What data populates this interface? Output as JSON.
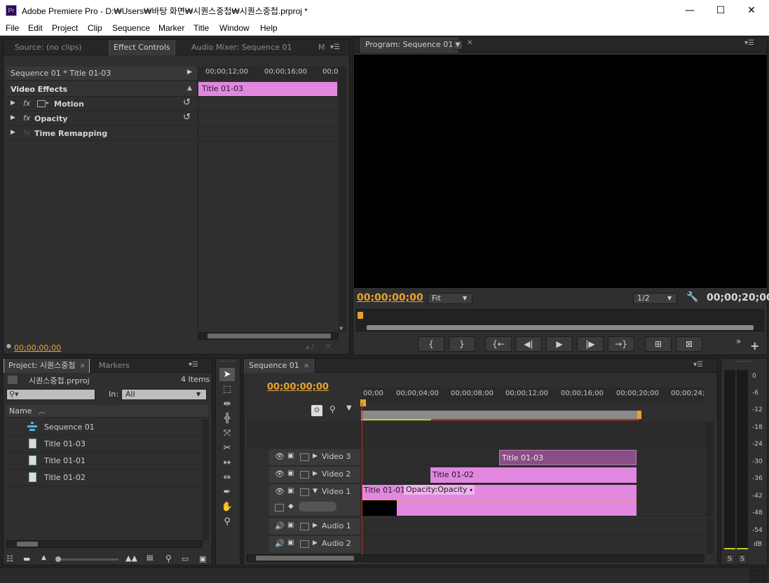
{
  "app": {
    "logo": "Pr",
    "window_title": "Adobe Premiere Pro - D:₩Users₩바탕 화면₩시퀀스중첩₩시퀀스중첩.prproj *",
    "minimize": "—",
    "maximize": "☐",
    "close": "✕"
  },
  "menu": [
    "File",
    "Edit",
    "Project",
    "Clip",
    "Sequence",
    "Marker",
    "Title",
    "Window",
    "Help"
  ],
  "source_panel": {
    "tabs": [
      "Source: (no clips)",
      "Effect Controls",
      "Audio Mixer: Sequence 01",
      "M"
    ],
    "effect_header": "Sequence 01 * Title 01-03",
    "ruler": [
      "00;00;12;00",
      "00;00;16;00",
      "00;0"
    ],
    "clip_label": "Title 01-03",
    "section": "Video Effects",
    "effects": [
      "Motion",
      "Opacity",
      "Time Remapping"
    ],
    "timecode": "00;00;00;00"
  },
  "program_panel": {
    "tab": "Program: Sequence 01",
    "current_time": "00;00;00;00",
    "fit": "Fit",
    "resolution": "1/2",
    "duration": "00;00;20;00",
    "controls": [
      "{",
      "}",
      "{←",
      "◀|",
      "▶",
      "|▶",
      "→}",
      "⊞",
      "⊠"
    ]
  },
  "project_panel": {
    "tabs": [
      "Project: 시퀀스중첩",
      "Markers"
    ],
    "project_name": "시퀀스중첩.prproj",
    "item_count": "4 Items",
    "search_placeholder": "",
    "in_label": "In:",
    "in_value": "All",
    "name_header": "Name",
    "items": [
      "Sequence 01",
      "Title 01-03",
      "Title 01-01",
      "Title 01-02"
    ]
  },
  "timeline_panel": {
    "tab": "Sequence 01",
    "timecode": "00;00;00;00",
    "ruler": [
      "00;00",
      "00;00;04;00",
      "00;00;08;00",
      "00;00;12;00",
      "00;00;16;00",
      "00;00;20;00",
      "00;00;24;"
    ],
    "tracks": [
      "Video 3",
      "Video 2",
      "Video 1",
      "Audio 1",
      "Audio 2"
    ],
    "clips": {
      "v3": "Title 01-03",
      "v2": "Title 01-02",
      "v1": "Title 01-01",
      "v1_effect": "Opacity:Opacity"
    }
  },
  "audio_meter": {
    "scale": [
      "0",
      "-6",
      "-12",
      "-18",
      "-24",
      "-30",
      "-36",
      "-42",
      "-48",
      "-54",
      "dB"
    ],
    "solo": [
      "S",
      "S"
    ]
  },
  "colors": {
    "accent_timecode": "#e8a32e",
    "clip_pink": "#e287e0",
    "clip_purple": "#8a4e86",
    "playhead": "#c8281e"
  }
}
